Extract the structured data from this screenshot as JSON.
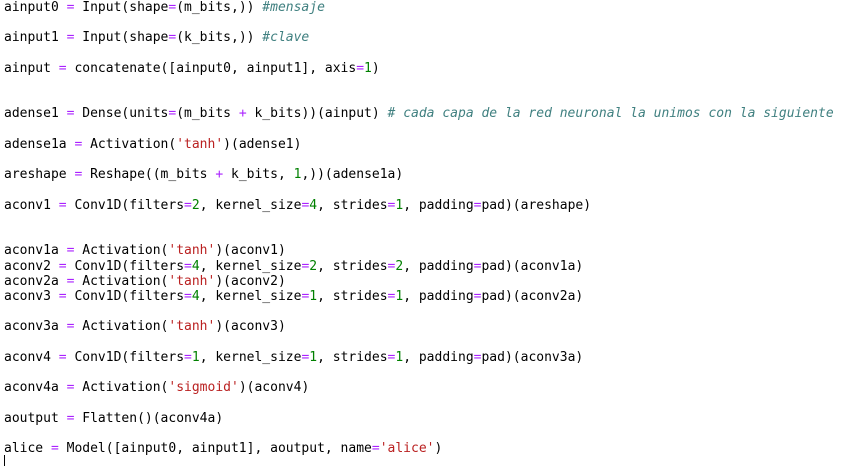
{
  "editor": {
    "lines": [
      [
        [
          "ainput0 ",
          ""
        ],
        [
          "=",
          "op"
        ],
        [
          " Input(shape",
          ""
        ],
        [
          "=",
          "op"
        ],
        [
          "(m_bits,)) ",
          ""
        ],
        [
          "#mensaje",
          "cm"
        ]
      ],
      [
        [
          "ainput1 ",
          ""
        ],
        [
          "=",
          "op"
        ],
        [
          " Input(shape",
          ""
        ],
        [
          "=",
          "op"
        ],
        [
          "(k_bits,)) ",
          ""
        ],
        [
          "#clave",
          "cm"
        ]
      ],
      [
        [
          "ainput ",
          ""
        ],
        [
          "=",
          "op"
        ],
        [
          " concatenate([ainput0, ainput1], axis",
          ""
        ],
        [
          "=",
          "op"
        ],
        [
          "1",
          "num"
        ],
        [
          ")",
          ""
        ]
      ],
      [
        [
          "adense1 ",
          ""
        ],
        [
          "=",
          "op"
        ],
        [
          " Dense(units",
          ""
        ],
        [
          "=",
          "op"
        ],
        [
          "(m_bits ",
          ""
        ],
        [
          "+",
          "op"
        ],
        [
          " k_bits))(ainput) ",
          ""
        ],
        [
          "# cada capa de la red neuronal la unimos con la siguiente",
          "cm"
        ]
      ],
      [
        [
          "adense1a ",
          ""
        ],
        [
          "=",
          "op"
        ],
        [
          " Activation(",
          ""
        ],
        [
          "'tanh'",
          "str"
        ],
        [
          ")(adense1)",
          ""
        ]
      ],
      [
        [
          "areshape ",
          ""
        ],
        [
          "=",
          "op"
        ],
        [
          " Reshape((m_bits ",
          ""
        ],
        [
          "+",
          "op"
        ],
        [
          " k_bits, ",
          ""
        ],
        [
          "1",
          "num"
        ],
        [
          ",))(adense1a)",
          ""
        ]
      ],
      [
        [
          "aconv1 ",
          ""
        ],
        [
          "=",
          "op"
        ],
        [
          " Conv1D(filters",
          ""
        ],
        [
          "=",
          "op"
        ],
        [
          "2",
          "num"
        ],
        [
          ", kernel_size",
          ""
        ],
        [
          "=",
          "op"
        ],
        [
          "4",
          "num"
        ],
        [
          ", strides",
          ""
        ],
        [
          "=",
          "op"
        ],
        [
          "1",
          "num"
        ],
        [
          ", padding",
          ""
        ],
        [
          "=",
          "op"
        ],
        [
          "pad)(areshape)",
          ""
        ]
      ],
      [
        [
          "aconv1a ",
          ""
        ],
        [
          "=",
          "op"
        ],
        [
          " Activation(",
          ""
        ],
        [
          "'tanh'",
          "str"
        ],
        [
          ")(aconv1)",
          ""
        ]
      ],
      [
        [
          "aconv2 ",
          ""
        ],
        [
          "=",
          "op"
        ],
        [
          " Conv1D(filters",
          ""
        ],
        [
          "=",
          "op"
        ],
        [
          "4",
          "num"
        ],
        [
          ", kernel_size",
          ""
        ],
        [
          "=",
          "op"
        ],
        [
          "2",
          "num"
        ],
        [
          ", strides",
          ""
        ],
        [
          "=",
          "op"
        ],
        [
          "2",
          "num"
        ],
        [
          ", padding",
          ""
        ],
        [
          "=",
          "op"
        ],
        [
          "pad)(aconv1a)",
          ""
        ]
      ],
      [
        [
          "aconv2a ",
          ""
        ],
        [
          "=",
          "op"
        ],
        [
          " Activation(",
          ""
        ],
        [
          "'tanh'",
          "str"
        ],
        [
          ")(aconv2)",
          ""
        ]
      ],
      [
        [
          "aconv3 ",
          ""
        ],
        [
          "=",
          "op"
        ],
        [
          " Conv1D(filters",
          ""
        ],
        [
          "=",
          "op"
        ],
        [
          "4",
          "num"
        ],
        [
          ", kernel_size",
          ""
        ],
        [
          "=",
          "op"
        ],
        [
          "1",
          "num"
        ],
        [
          ", strides",
          ""
        ],
        [
          "=",
          "op"
        ],
        [
          "1",
          "num"
        ],
        [
          ", padding",
          ""
        ],
        [
          "=",
          "op"
        ],
        [
          "pad)(aconv2a)",
          ""
        ]
      ],
      [
        [
          "aconv3a ",
          ""
        ],
        [
          "=",
          "op"
        ],
        [
          " Activation(",
          ""
        ],
        [
          "'tanh'",
          "str"
        ],
        [
          ")(aconv3)",
          ""
        ]
      ],
      [
        [
          "aconv4 ",
          ""
        ],
        [
          "=",
          "op"
        ],
        [
          " Conv1D(filters",
          ""
        ],
        [
          "=",
          "op"
        ],
        [
          "1",
          "num"
        ],
        [
          ", kernel_size",
          ""
        ],
        [
          "=",
          "op"
        ],
        [
          "1",
          "num"
        ],
        [
          ", strides",
          ""
        ],
        [
          "=",
          "op"
        ],
        [
          "1",
          "num"
        ],
        [
          ", padding",
          ""
        ],
        [
          "=",
          "op"
        ],
        [
          "pad)(aconv3a)",
          ""
        ]
      ],
      [
        [
          "aconv4a ",
          ""
        ],
        [
          "=",
          "op"
        ],
        [
          " Activation(",
          ""
        ],
        [
          "'sigmoid'",
          "str"
        ],
        [
          ")(aconv4)",
          ""
        ]
      ],
      [
        [
          "aoutput ",
          ""
        ],
        [
          "=",
          "op"
        ],
        [
          " Flatten()(aconv4a)",
          ""
        ]
      ],
      [
        [
          "alice ",
          ""
        ],
        [
          "=",
          "op"
        ],
        [
          " Model([ainput0, ainput1], aoutput, name",
          ""
        ],
        [
          "=",
          "op"
        ],
        [
          "'alice'",
          "str"
        ],
        [
          ")",
          ""
        ]
      ]
    ]
  },
  "colors": {
    "background": "#ffffff",
    "text": "#000000",
    "operator": "#aa22ff",
    "number": "#008000",
    "string": "#ba2121",
    "comment": "#408080"
  }
}
